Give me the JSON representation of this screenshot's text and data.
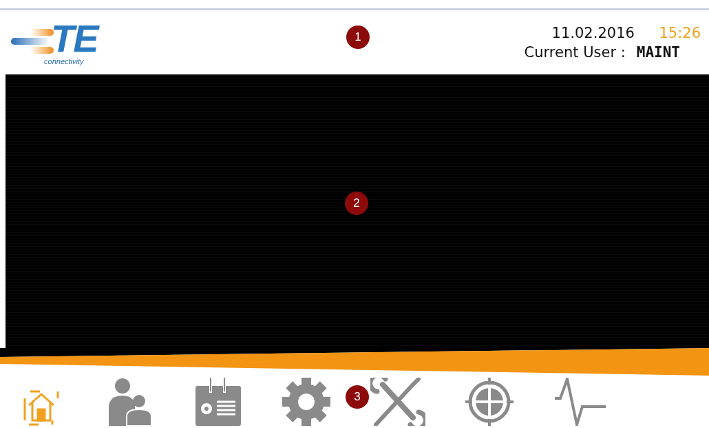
{
  "header": {
    "logo": {
      "mark": "TE",
      "tagline": "connectivity"
    },
    "marker": "1",
    "date": "11.02.2016",
    "time": "15:26",
    "user_label": "Current User :",
    "user": "MAINT"
  },
  "content": {
    "marker": "2"
  },
  "nav": {
    "marker": "3",
    "items": [
      {
        "kind": "home",
        "selected": true
      },
      {
        "kind": "users",
        "selected": false
      },
      {
        "kind": "recipe",
        "selected": false
      },
      {
        "kind": "settings",
        "selected": false
      },
      {
        "kind": "tools",
        "selected": false
      },
      {
        "kind": "target",
        "selected": false
      },
      {
        "kind": "signal",
        "selected": false
      }
    ]
  }
}
